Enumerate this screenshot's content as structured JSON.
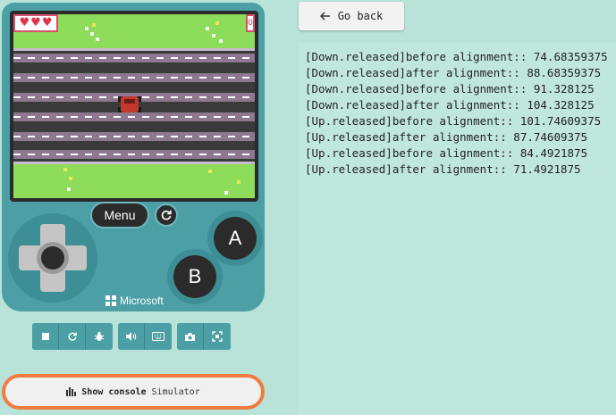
{
  "simulator": {
    "hud": {
      "hearts": [
        "♥",
        "♥",
        "♥"
      ],
      "score": "0"
    },
    "menu_label": "Menu",
    "a_label": "A",
    "b_label": "B",
    "brand": "Microsoft",
    "toolbar": {
      "groups": [
        [
          "stop-icon",
          "restart-icon",
          "debug-icon"
        ],
        [
          "mute-icon",
          "keyboard-icon"
        ],
        [
          "screenshot-icon",
          "fullscreen-icon"
        ]
      ]
    },
    "console_bar": {
      "label": "Show console",
      "sublabel": "Simulator"
    }
  },
  "console": {
    "back_label": "Go back",
    "lines": [
      "[Down.released]before alignment:: 74.68359375",
      "[Down.released]after alignment:: 88.68359375",
      "[Down.released]before alignment:: 91.328125",
      "[Down.released]after alignment:: 104.328125",
      "[Up.released]before alignment:: 101.74609375",
      "[Up.released]after alignment:: 87.74609375",
      "[Up.released]before alignment:: 84.4921875",
      "[Up.released]after alignment:: 71.4921875"
    ]
  },
  "colors": {
    "background": "#b9e2d8",
    "device": "#4b9fa5",
    "console_accent": "#f07b3f",
    "grass": "#8ddc5a",
    "road": "#3a3a3a",
    "car": "#c0392b"
  }
}
